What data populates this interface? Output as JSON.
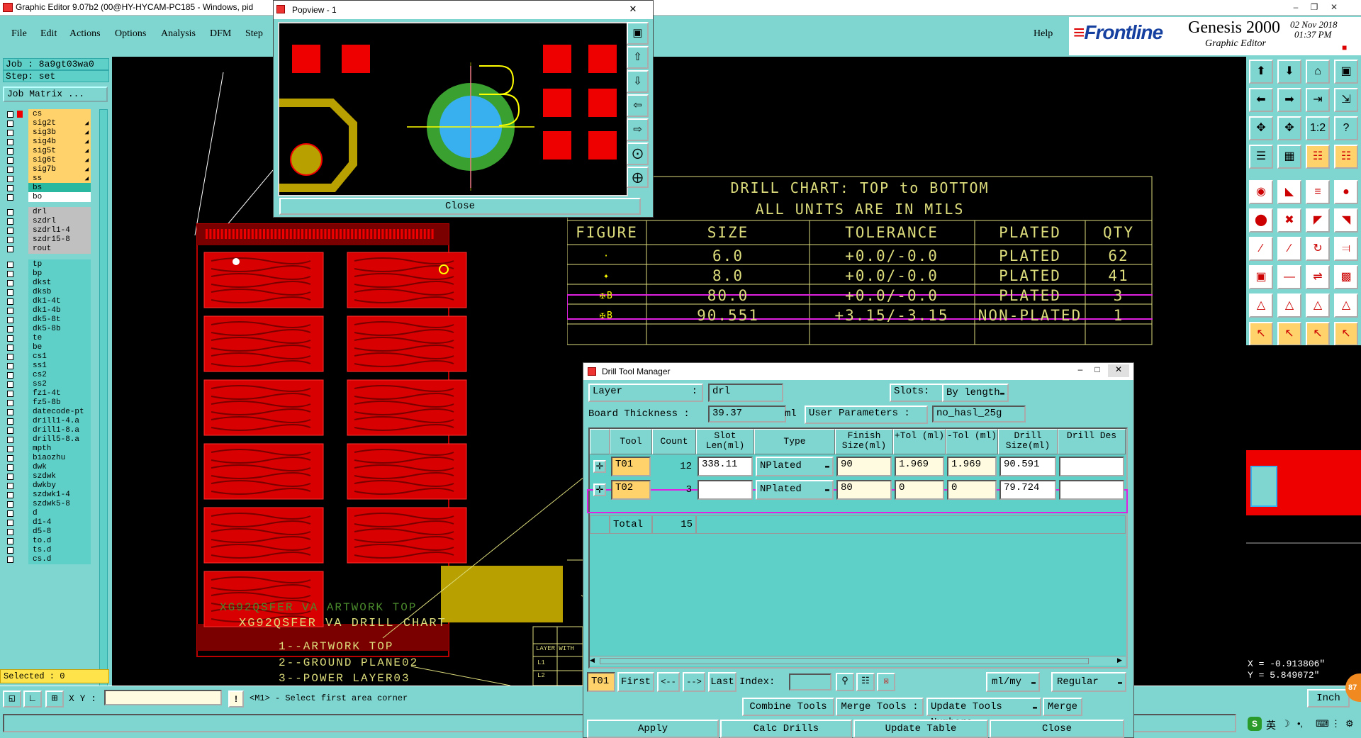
{
  "window": {
    "title": "Graphic Editor 9.07b2 (00@HY-HYCAM-PC185 - Windows, pid"
  },
  "menu": [
    "File",
    "Edit",
    "Actions",
    "Options",
    "Analysis",
    "DFM",
    "Step"
  ],
  "help_label": "Help",
  "brand": {
    "logo": "Frontline",
    "product": "Genesis 2000",
    "subtitle": "Graphic Editor",
    "date": "02 Nov 2018",
    "time": "01:37 PM"
  },
  "job": {
    "job_line": "Job : 8a9gt03wa0",
    "step_line": "Step: set",
    "matrix_button": "Job Matrix ..."
  },
  "layers_group1": [
    "cs",
    "sig2t",
    "sig3b",
    "sig4b",
    "sig5t",
    "sig6t",
    "sig7b",
    "ss",
    "bs",
    "bo"
  ],
  "layers_group2": [
    "drl",
    "szdrl",
    "szdrl1-4",
    "szdr15-8",
    "rout"
  ],
  "layers_group3": [
    "tp",
    "bp",
    "dkst",
    "dksb",
    "dk1-4t",
    "dk1-4b",
    "dk5-8t",
    "dk5-8b",
    "te",
    "be",
    "cs1",
    "ss1",
    "cs2",
    "ss2",
    "fz1-4t",
    "fz5-8b",
    "datecode-pt",
    "drill1-4.a",
    "drill1-8.a",
    "drill5-8.a",
    "mpth",
    "biaozhu",
    "dwk",
    "szdwk",
    "dwkby",
    "szdwk1-4",
    "szdwk5-8",
    "d",
    "d1-4",
    "d5-8",
    "to.d",
    "ts.d",
    "cs.d"
  ],
  "selected_text": "Selected : 0",
  "status": {
    "xy_label": "X Y :",
    "xy_value": "",
    "prompt": "<M1> - Select first area corner",
    "units": "Inch",
    "coord_x": "X = -0.913806\"",
    "coord_y": "Y = 5.849072\""
  },
  "popview": {
    "title": "Popview - 1",
    "close_label": "Close"
  },
  "artwork_labels": {
    "line1": "XG92QSFER VA ARTWORK TOP",
    "line2": "XG92QSFER VA DRILL CHART",
    "list1": "1--ARTWORK TOP",
    "list2": "2--GROUND PLANE02",
    "list3": "3--POWER LAYER03",
    "layer_with": "LAYER WITH",
    "l1": "L1",
    "l2": "L2"
  },
  "drill_chart": {
    "title1": "DRILL CHART: TOP to BOTTOM",
    "title2": "ALL UNITS ARE IN MILS",
    "headers": [
      "FIGURE",
      "SIZE",
      "TOLERANCE",
      "PLATED",
      "QTY"
    ],
    "rows": [
      {
        "size": "6.0",
        "tol": "+0.0/-0.0",
        "plated": "PLATED",
        "qty": "62"
      },
      {
        "size": "8.0",
        "tol": "+0.0/-0.0",
        "plated": "PLATED",
        "qty": "41"
      },
      {
        "size": "80.0",
        "tol": "+0.0/-0.0",
        "plated": "PLATED",
        "qty": "3"
      },
      {
        "size": "90.551",
        "tol": "+3.15/-3.15",
        "plated": "NON-PLATED",
        "qty": "1"
      }
    ]
  },
  "dtm": {
    "title": "Drill Tool Manager",
    "layer_label": "Layer",
    "layer_value": "drl",
    "slots_label": "Slots:",
    "slots_value": "By length",
    "thickness_label": "Board Thickness :",
    "thickness_value": "39.37",
    "thickness_unit": "ml",
    "user_params_label": "User Parameters :",
    "user_params_value": "no_hasl_25g",
    "columns": [
      "Tool",
      "Count",
      "Slot Len(ml)",
      "Type",
      "Finish Size(ml)",
      "+Tol (ml)",
      "-Tol (ml)",
      "Drill Size(ml)",
      "Drill Des"
    ],
    "rows": [
      {
        "tool": "T01",
        "count": "12",
        "slot": "338.11",
        "type": "NPlated",
        "finish": "90",
        "ptol": "1.969",
        "ntol": "1.969",
        "drill": "90.591",
        "des": ""
      },
      {
        "tool": "T02",
        "count": "3",
        "slot": "",
        "type": "NPlated",
        "finish": "80",
        "ptol": "0",
        "ntol": "0",
        "drill": "79.724",
        "des": ""
      }
    ],
    "total_label": "Total",
    "total_value": "15",
    "current_tool": "T01",
    "nav": {
      "first": "First",
      "prev": "<--",
      "next": "-->",
      "last": "Last",
      "index": "Index:"
    },
    "units_select": "ml/my",
    "mode_select": "Regular",
    "buttons_row1": [
      "Combine Tools",
      "Merge Tools :",
      "Update Tools Numbers",
      "Merge"
    ],
    "buttons_row2": [
      "Apply",
      "Calc Drills",
      "Update Table",
      "Close"
    ]
  },
  "taskbar": {
    "ime": "英",
    "badge": "87"
  },
  "colors": {
    "panel": "#7fd6d0",
    "accent_yellow": "#ffd26b",
    "drill_chart_text": "#dcdc7c",
    "highlight": "#e020e0",
    "pcb_red": "#e00000"
  }
}
